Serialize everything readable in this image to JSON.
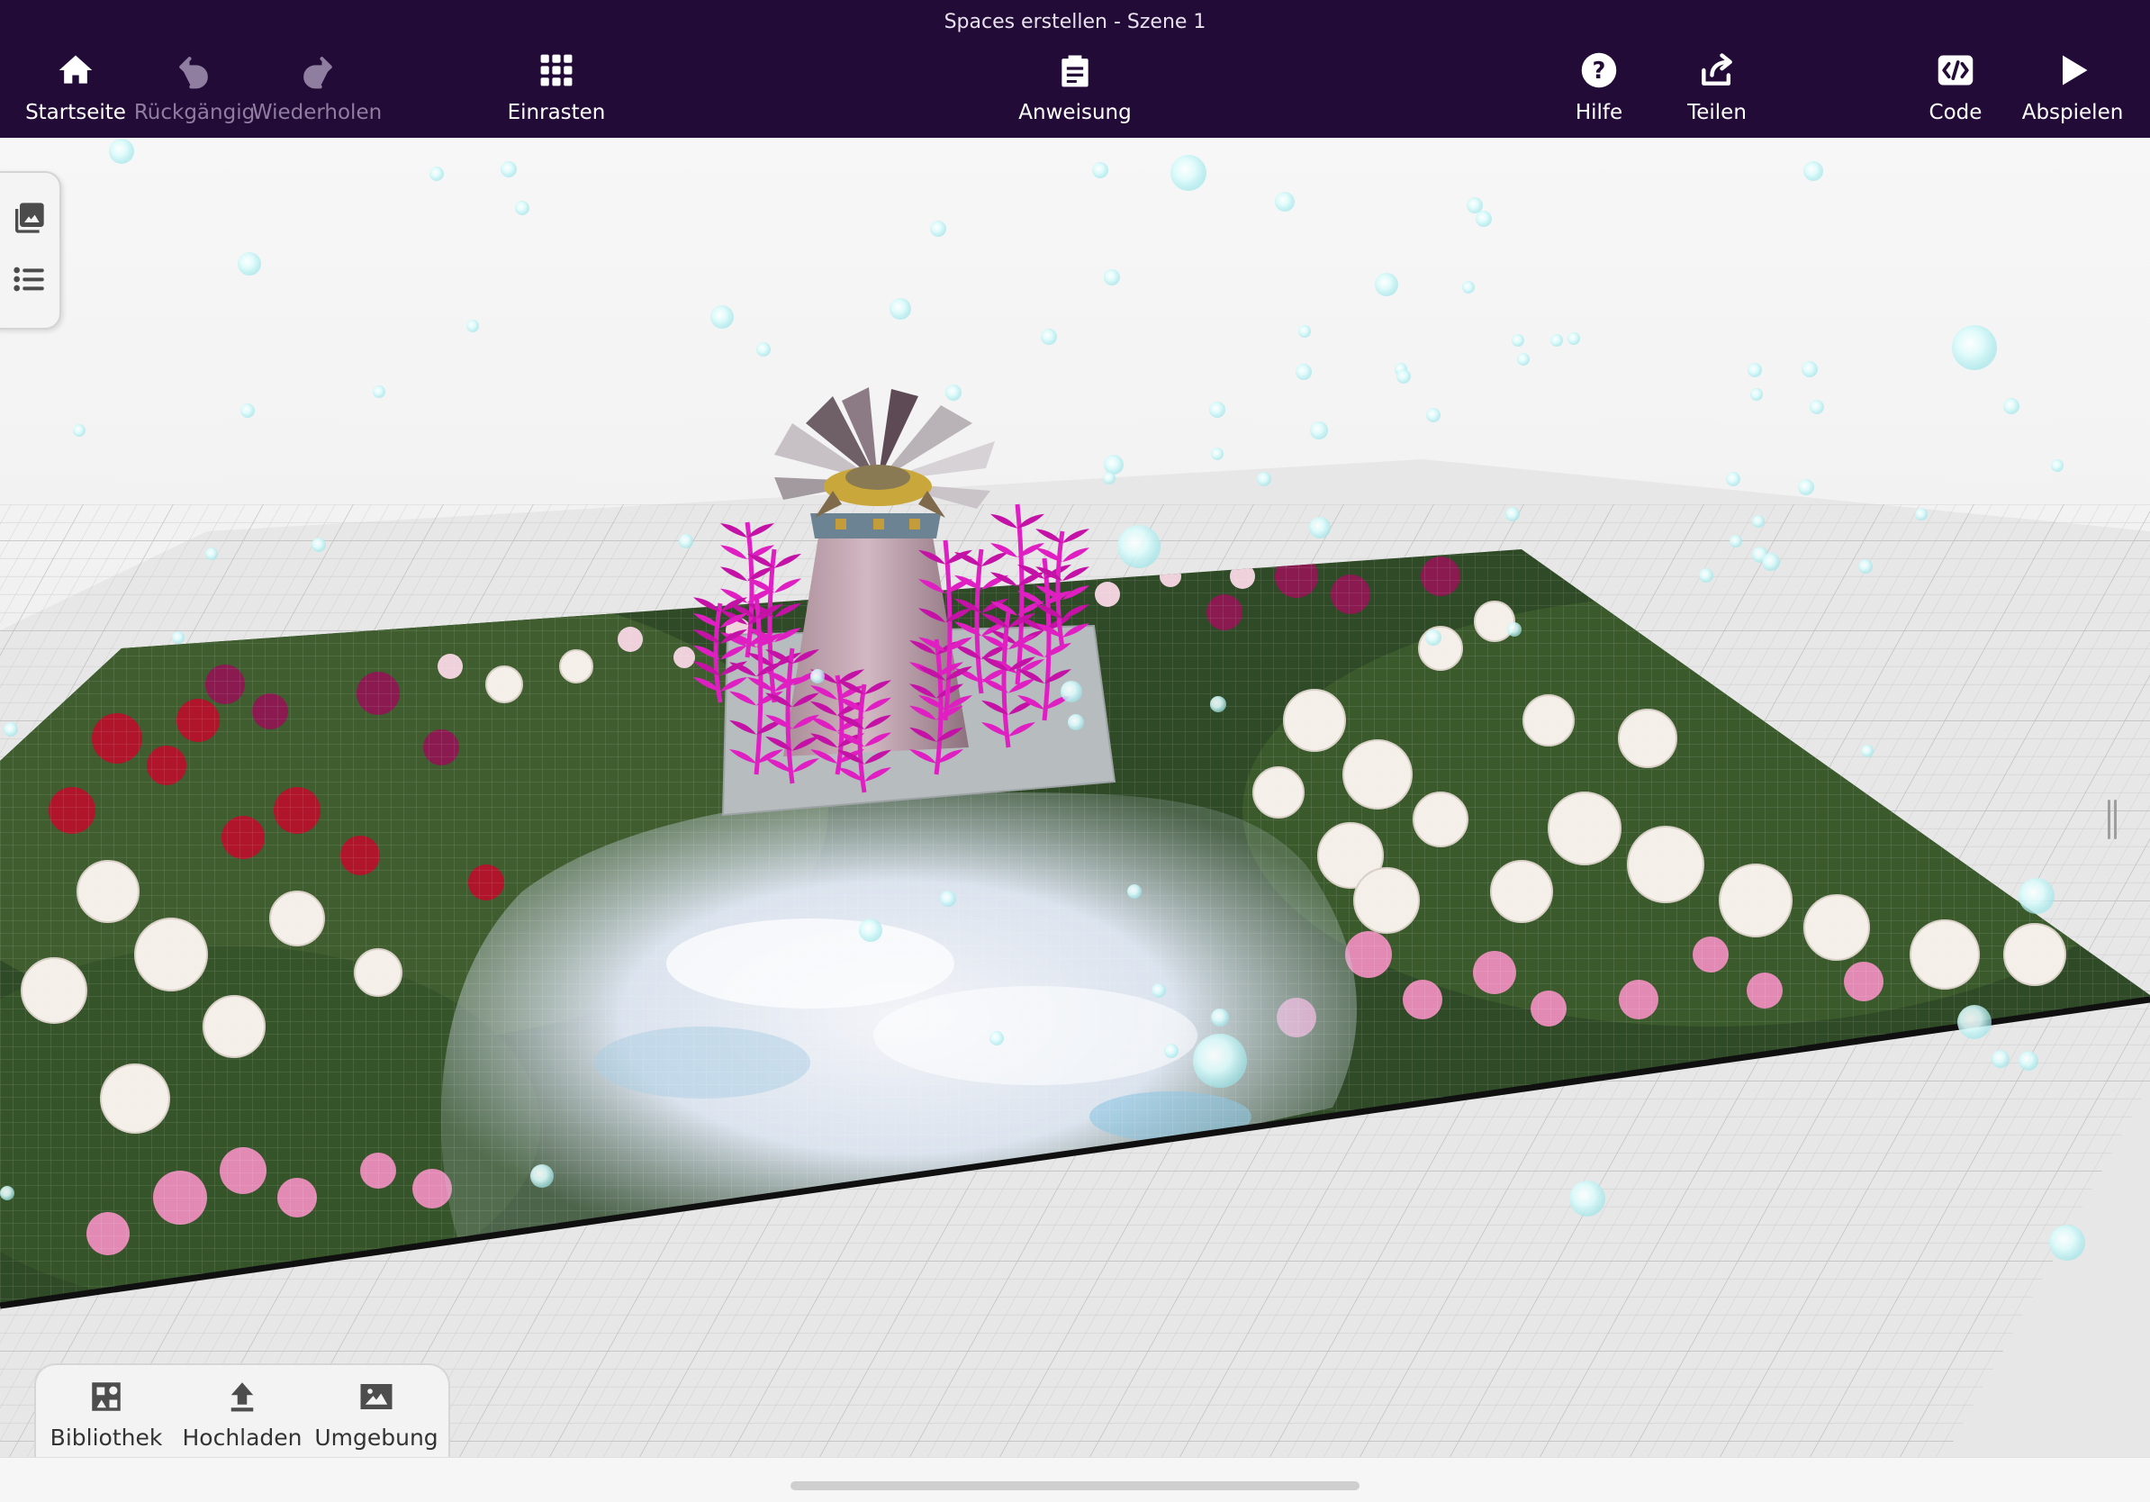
{
  "window": {
    "title": "Spaces erstellen - Szene 1"
  },
  "toolbar": {
    "home_label": "Startseite",
    "undo_label": "Rückgängig",
    "redo_label": "Wiederholen",
    "snap_label": "Einrasten",
    "instruction_label": "Anweisung",
    "help_label": "Hilfe",
    "share_label": "Teilen",
    "code_label": "Code",
    "play_label": "Abspielen"
  },
  "side_panel": {
    "icons": [
      "gallery-icon",
      "list-icon"
    ]
  },
  "bottom_tabs": {
    "library_label": "Bibliothek",
    "upload_label": "Hochladen",
    "environment_label": "Umgebung"
  },
  "colors": {
    "toolbar_bg": "#230b38",
    "toolbar_text": "#ffffff",
    "disabled_text": "#8f7ea0",
    "plant_magenta": "#e01fc3",
    "bubble_cyan": "#bff4f5"
  },
  "state": {
    "undo_enabled": false,
    "redo_enabled": false
  }
}
